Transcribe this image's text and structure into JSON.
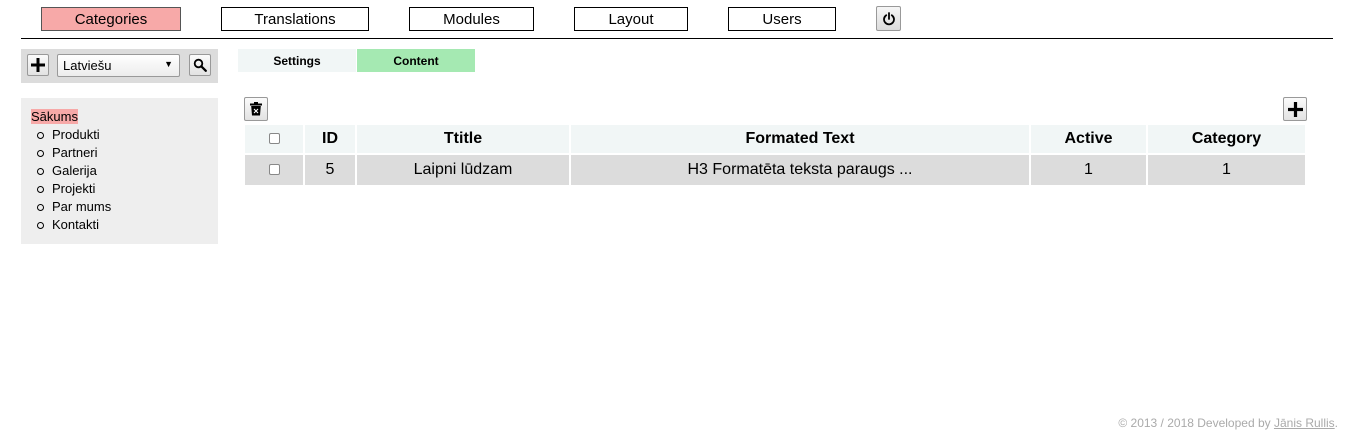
{
  "nav": {
    "items": [
      {
        "label": "Categories"
      },
      {
        "label": "Translations"
      },
      {
        "label": "Modules"
      },
      {
        "label": "Layout"
      },
      {
        "label": "Users"
      }
    ]
  },
  "sidebar": {
    "language": "Latviešu",
    "tree": {
      "root": "Sākums",
      "children": [
        "Produkti",
        "Partneri",
        "Galerija",
        "Projekti",
        "Par mums",
        "Kontakti"
      ]
    }
  },
  "tabs": [
    {
      "label": "Settings"
    },
    {
      "label": "Content"
    }
  ],
  "table": {
    "columns": [
      "ID",
      "Ttitle",
      "Formated Text",
      "Active",
      "Category"
    ],
    "rows": [
      {
        "id": "5",
        "title": "Laipni lūdzam",
        "text": "H3 Formatēta teksta paraugs ...",
        "active": "1",
        "category": "1"
      }
    ]
  },
  "footer": {
    "prefix": "© 2013 / 2018 Developed by ",
    "author": "Jānis Rullis",
    "suffix": "."
  },
  "colors": {
    "active_nav": "#f7a9a8",
    "active_tab": "#a5e9b2"
  }
}
